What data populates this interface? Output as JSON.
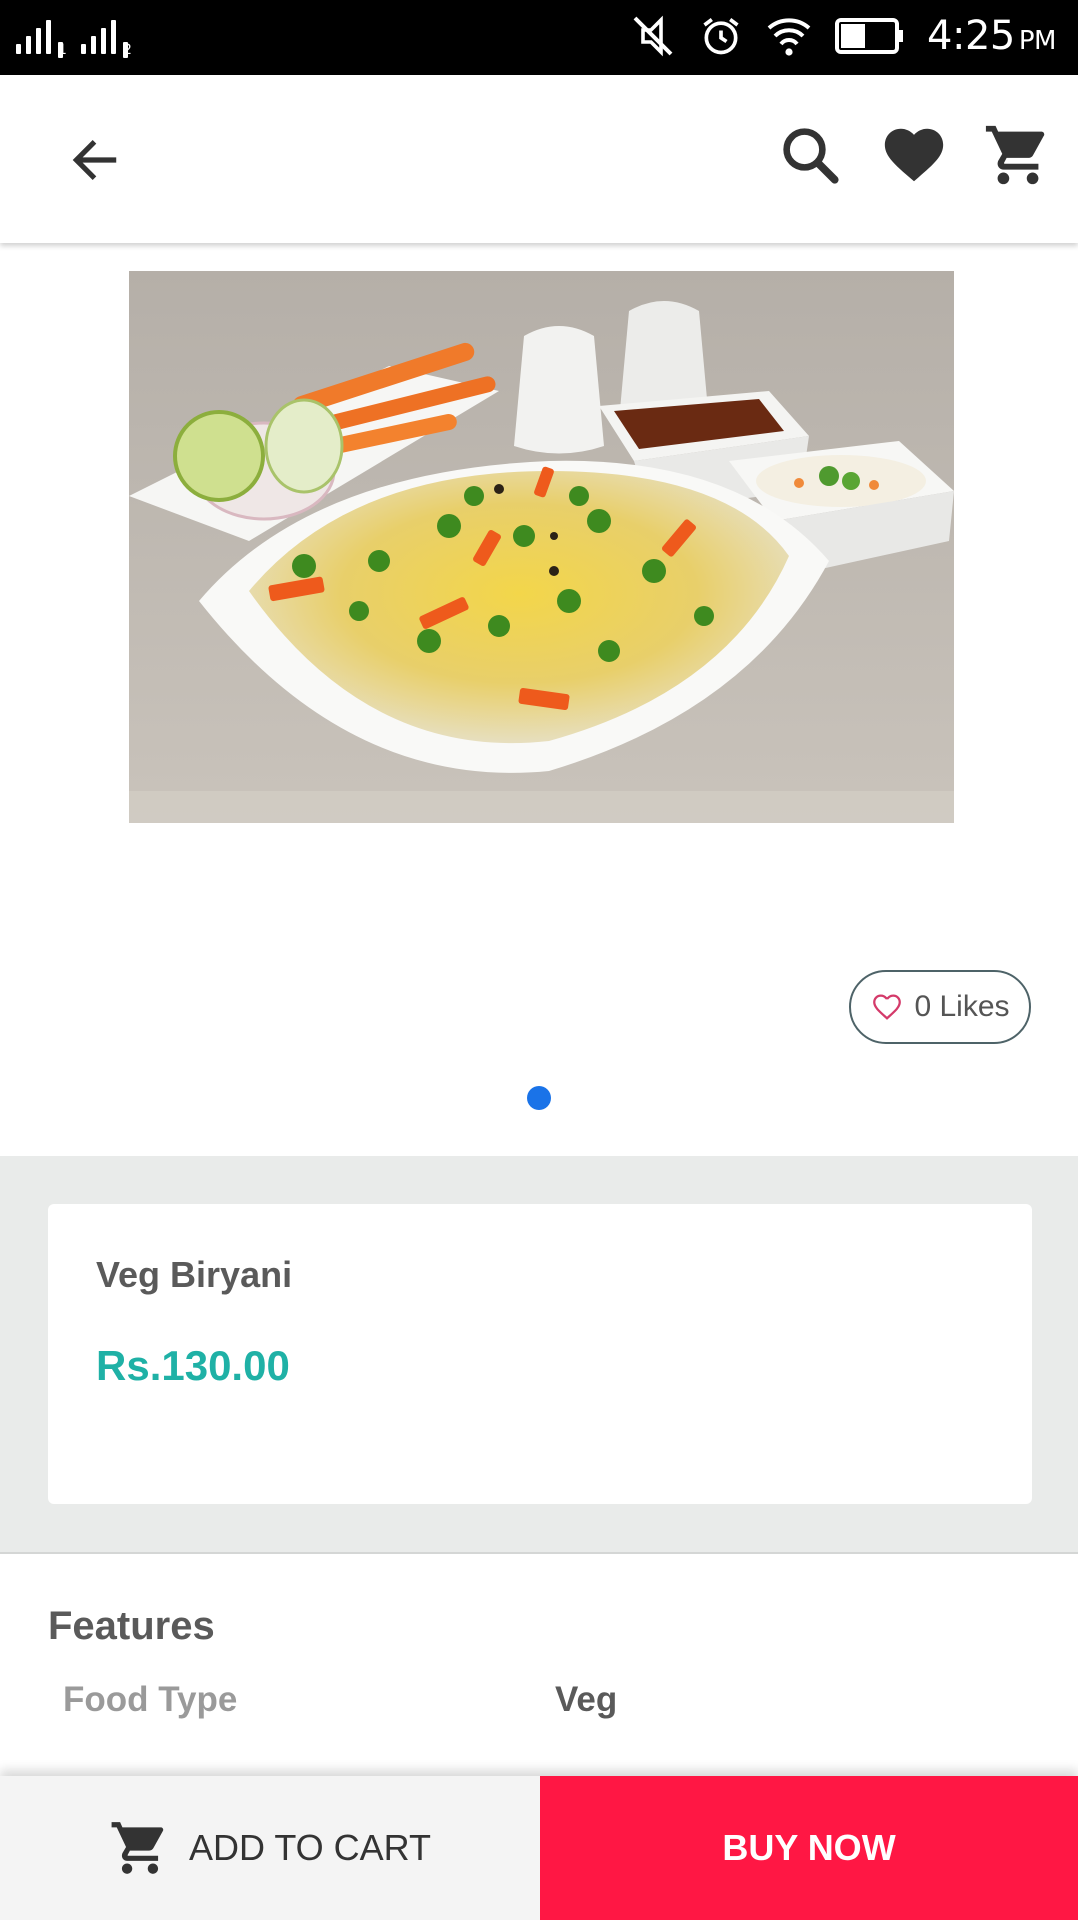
{
  "status_bar": {
    "sim1_index": "1",
    "sim2_index": "2",
    "time": "4:25",
    "ampm": "PM",
    "icons": [
      "signal-icon",
      "signal-icon",
      "mute-icon",
      "alarm-icon",
      "wifi-icon",
      "battery-icon"
    ]
  },
  "app_bar": {
    "icons": [
      "back-arrow-icon",
      "search-icon",
      "heart-icon",
      "cart-icon"
    ]
  },
  "product": {
    "image_alt": "Veg Biryani plate with vegetables, raita and sauce",
    "likes_label": "0 Likes",
    "name": "Veg Biryani",
    "price": "Rs.130.00"
  },
  "carousel": {
    "current_page": 1,
    "total_pages": 1
  },
  "features": {
    "title": "Features",
    "rows": [
      {
        "label": "Food Type",
        "value": "Veg"
      }
    ]
  },
  "bottom_bar": {
    "add_to_cart_label": "ADD TO CART",
    "buy_now_label": "BUY NOW"
  },
  "colors": {
    "accent_blue": "#1a73e8",
    "price_teal": "#1fb1a6",
    "buy_now_red": "#ff1744",
    "section_grey": "#e9ebea"
  }
}
